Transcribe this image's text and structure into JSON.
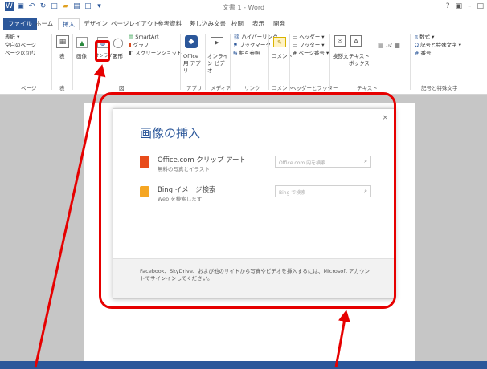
{
  "title_bar": {
    "document_title": "文書 1 - Word",
    "window_controls": [
      "?",
      "▣",
      "–",
      "□"
    ]
  },
  "tabs": [
    {
      "label": "ファイル"
    },
    {
      "label": "ホーム"
    },
    {
      "label": "挿入"
    },
    {
      "label": "デザイン"
    },
    {
      "label": "ページレイアウト"
    },
    {
      "label": "参考資料"
    },
    {
      "label": "差し込み文書"
    },
    {
      "label": "校閲"
    },
    {
      "label": "表示"
    },
    {
      "label": "開発"
    }
  ],
  "ribbon": {
    "pages": {
      "items": [
        "表紙 ▾",
        "空白のページ",
        "ページ区切り"
      ],
      "group_label": "ページ"
    },
    "table": {
      "button": "表",
      "group_label": "表"
    },
    "illustrations": {
      "picture": "画像",
      "online_pictures": "オンライン",
      "shapes": "図形",
      "smartart": "SmartArt",
      "chart": "グラフ",
      "screenshot": "スクリーンショット",
      "group_label": "図"
    },
    "apps": {
      "button": "Office 用 アプリ",
      "group_label": "アプリ"
    },
    "media": {
      "button": "オンライン ビデオ",
      "group_label": "メディア"
    },
    "links": {
      "items": [
        "ハイパーリンク",
        "ブックマーク",
        "相互参照"
      ],
      "group_label": "リンク"
    },
    "comments": {
      "button": "コメント",
      "group_label": "コメント"
    },
    "header_footer": {
      "items": [
        "ヘッダー ▾",
        "フッター ▾",
        "ページ番号 ▾"
      ],
      "group_label": "ヘッダーとフッター"
    },
    "text": {
      "items": [
        "挨拶文",
        "テキスト ボックス"
      ],
      "group_label": "テキスト"
    },
    "symbols": {
      "items": [
        "数式 ▾",
        "記号と特殊文字 ▾",
        "番号"
      ],
      "group_label": "記号と特殊文字"
    }
  },
  "dialog": {
    "title": "画像の挿入",
    "close": "×",
    "sources": [
      {
        "name": "Office.com クリップ アート",
        "description": "無料の写真とイラスト",
        "placeholder": "Office.com 内を検索",
        "color": "#e84c1b"
      },
      {
        "name": "Bing イメージ検索",
        "description": "Web を検索します",
        "placeholder": "Bing で検索",
        "color": "#f5a623"
      }
    ],
    "footer": "Facebook、SkyDrive、および他のサイトから写真やビデオを挿入するには、Microsoft アカウントでサインインしてください。"
  },
  "colors": {
    "accent": "#2b579a",
    "annotation": "#e60000"
  }
}
